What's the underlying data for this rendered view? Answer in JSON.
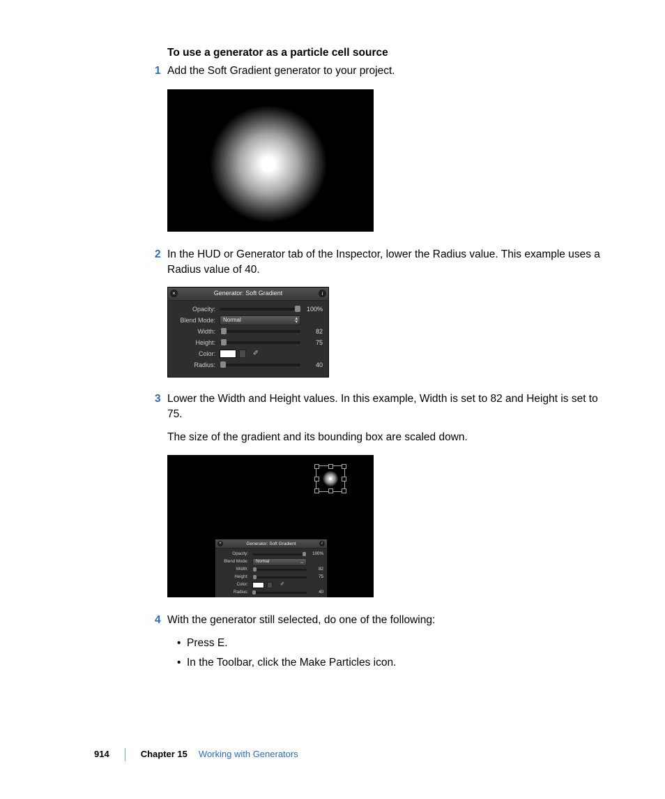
{
  "heading": "To use a generator as a particle cell source",
  "steps": [
    {
      "text": "Add the Soft Gradient generator to your project."
    },
    {
      "text": "In the HUD or Generator tab of the Inspector, lower the Radius value. This example uses a Radius value of 40."
    },
    {
      "text": "Lower the Width and Height values. In this example, Width is set to 82 and Height is set to 75.",
      "followup": "The size of the gradient and its bounding box are scaled down."
    },
    {
      "text": "With the generator still selected, do one of the following:",
      "bullets": [
        "Press E.",
        "In the Toolbar, click the Make Particles icon."
      ]
    }
  ],
  "hud": {
    "title": "Generator: Soft Gradient",
    "rows": {
      "opacity": {
        "label": "Opacity:",
        "value": "100%",
        "thumbPct": 100
      },
      "blend": {
        "label": "Blend Mode:",
        "value": "Normal"
      },
      "width": {
        "label": "Width:",
        "value": "82",
        "thumbPct": 4
      },
      "height": {
        "label": "Height:",
        "value": "75",
        "thumbPct": 4
      },
      "color": {
        "label": "Color:"
      },
      "radius": {
        "label": "Radius:",
        "value": "40",
        "thumbPct": 2
      }
    }
  },
  "footer": {
    "page": "914",
    "chapter": "Chapter 15",
    "title": "Working with Generators"
  }
}
